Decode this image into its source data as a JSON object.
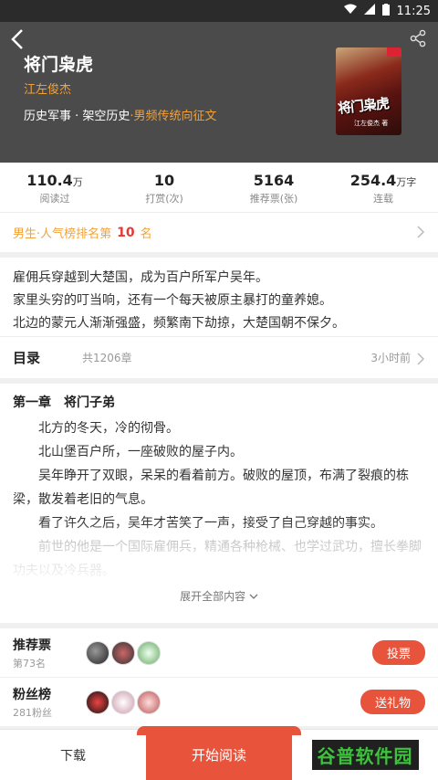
{
  "status": {
    "time": "11:25"
  },
  "book": {
    "title": "将门枭虎",
    "author": "江左俊杰",
    "tags": "历史军事 · 架空历史",
    "tag_accent": "·男频传统向征文",
    "cover_text": "将门枭虎",
    "cover_author": "江左俊杰 著"
  },
  "stats": [
    {
      "num": "110.4",
      "unit": "万",
      "label": "阅读过"
    },
    {
      "num": "10",
      "unit": "",
      "label": "打赏(次)"
    },
    {
      "num": "5164",
      "unit": "",
      "label": "推荐票(张)"
    },
    {
      "num": "254.4",
      "unit": "万字",
      "label": "连载"
    }
  ],
  "rank": {
    "prefix": "男生·人气榜排名第",
    "number": "10",
    "suffix": "名"
  },
  "intro": [
    "雇佣兵穿越到大楚国，成为百户所军户吴年。",
    "家里头穷的叮当响，还有一个每天被原主暴打的童养媳。",
    "北边的蒙元人渐渐强盛，频繁南下劫掠，大楚国朝不保夕。"
  ],
  "toc": {
    "label": "目录",
    "count": "共1206章",
    "updated": "3小时前"
  },
  "chapter": {
    "title": "第一章　将门子弟",
    "paragraphs": [
      "北方的冬天，冷的彻骨。",
      "北山堡百户所，一座破败的屋子内。",
      "吴年睁开了双眼，呆呆的看着前方。破败的屋顶，布满了裂痕的栋梁，散发着老旧的气息。",
      "看了许久之后，吴年才苦笑了一声，接受了自己穿越的事实。",
      "前世的他是一个国际雇佣兵，精通各种枪械、也学过武功，擅长拳脚功夫以及冷兵器。"
    ],
    "expand": "展开全部内容"
  },
  "fans": [
    {
      "name": "推荐票",
      "sub": "第73名",
      "button": "投票"
    },
    {
      "name": "粉丝榜",
      "sub": "281粉丝",
      "button": "送礼物"
    }
  ],
  "bottom": {
    "download": "下载",
    "read": "开始阅读",
    "logo": "谷普软件园"
  },
  "colors": {
    "accent": "#e8533b",
    "gold": "#f2a23b",
    "header": "#4b4b4b"
  }
}
